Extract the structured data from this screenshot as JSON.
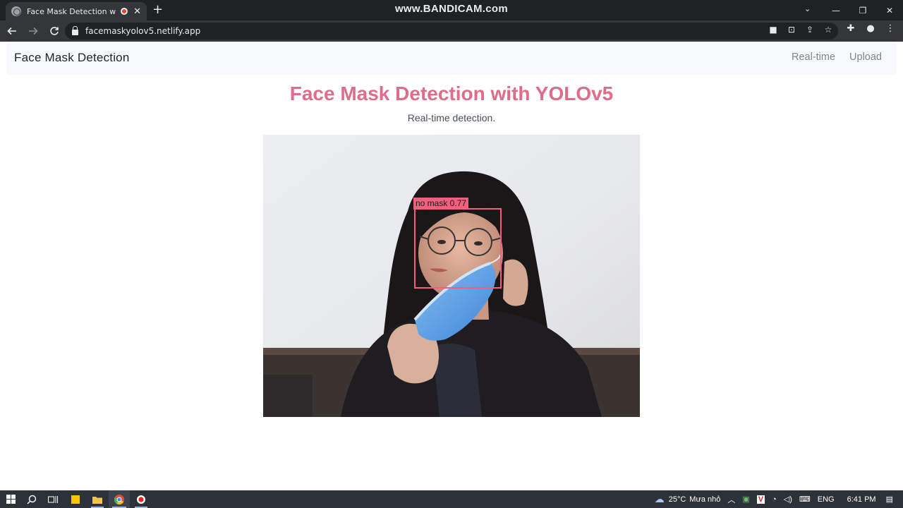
{
  "browser": {
    "tab_title": "Face Mask Detection with YOLOv5",
    "tab_close": "✕",
    "new_tab": "+",
    "watermark": "www.BANDICAM.com",
    "url": "facemaskyolov5.netlify.app",
    "window_controls": {
      "tab_search": "⌄",
      "minimize": "—",
      "maximize": "❐",
      "close": "✕"
    }
  },
  "navbar": {
    "brand": "Face Mask Detection",
    "links": [
      "Real-time",
      "Upload"
    ]
  },
  "main": {
    "title": "Face Mask Detection with YOLOv5",
    "subtitle": "Real-time detection."
  },
  "detection": {
    "label": "no mask 0.77",
    "color": "#f0607e"
  },
  "colors": {
    "accent": "#e06c8a",
    "navbar_bg": "#f8f9fa",
    "chrome_dark": "#202124",
    "taskbar_bg": "#2d3138"
  },
  "taskbar": {
    "weather_temp": "25°C",
    "weather_desc": "Mưa nhỏ",
    "language": "ENG",
    "time": "6:41 PM"
  }
}
